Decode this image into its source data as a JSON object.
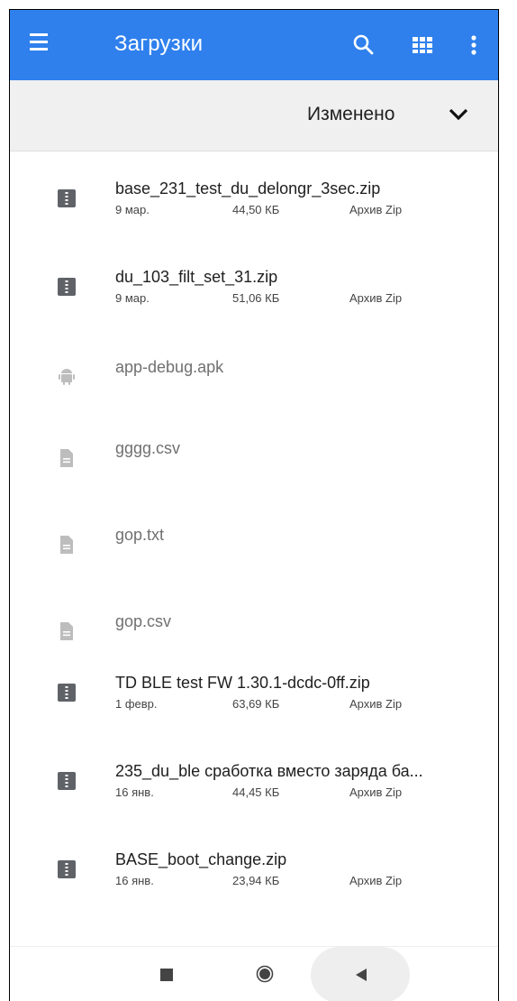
{
  "appbar": {
    "title": "Загрузки",
    "color": "#2f80ed",
    "icons": [
      "menu-icon",
      "search-icon",
      "grid-view-icon",
      "more-vert-icon"
    ]
  },
  "sort": {
    "label": "Изменено",
    "icon": "chevron-down-icon"
  },
  "files": [
    {
      "name": "base_231_test_du_delongr_3sec.zip",
      "date": "9 мар.",
      "size": "44,50 КБ",
      "kind": "Архив Zip",
      "icon": "zip-icon",
      "dimmed": false
    },
    {
      "name": "du_103_filt_set_31.zip",
      "date": "9 мар.",
      "size": "51,06 КБ",
      "kind": "Архив Zip",
      "icon": "zip-icon",
      "dimmed": false
    },
    {
      "name": "app-debug.apk",
      "icon": "android-icon",
      "dimmed": true
    },
    {
      "name": "gggg.csv",
      "icon": "document-icon",
      "dimmed": true
    },
    {
      "name": "gop.txt",
      "icon": "document-icon",
      "dimmed": true
    },
    {
      "name": "gop.csv",
      "icon": "document-icon",
      "dimmed": true
    },
    {
      "name": "TD BLE test FW 1.30.1-dcdc-0ff.zip",
      "date": "1 февр.",
      "size": "63,69 КБ",
      "kind": "Архив Zip",
      "icon": "zip-icon",
      "dimmed": false
    },
    {
      "name": "235_du_ble сработка вместо заряда ба...",
      "date": "16 янв.",
      "size": "44,45 КБ",
      "kind": "Архив Zip",
      "icon": "zip-icon",
      "dimmed": false
    },
    {
      "name": "BASE_boot_change.zip",
      "date": "16 янв.",
      "size": "23,94 КБ",
      "kind": "Архив Zip",
      "icon": "zip-icon",
      "dimmed": false
    }
  ],
  "navbar": {
    "icons": [
      "recents-icon",
      "home-icon",
      "back-icon"
    ]
  }
}
